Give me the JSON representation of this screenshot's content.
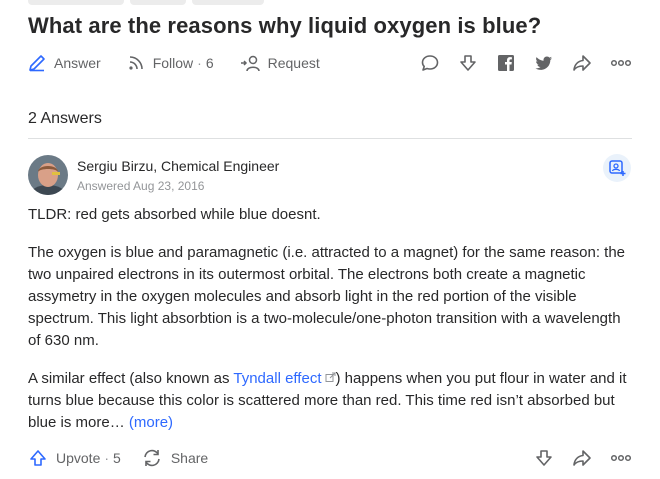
{
  "question": {
    "title": "What are the reasons why liquid oxygen is blue?"
  },
  "actions": {
    "answer_label": "Answer",
    "follow_label": "Follow",
    "follow_count": "6",
    "request_label": "Request"
  },
  "answers_header": "2 Answers",
  "answer": {
    "author": "Sergiu Birzu, Chemical Engineer",
    "answered": "Answered Aug 23, 2016",
    "tldr": "TLDR: red gets absorbed while blue doesnt.",
    "para1": "The oxygen is blue and paramagnetic (i.e. attracted to a magnet) for the same reason: the two unpaired electrons in its outermost orbital. The electrons both create a magnetic assymetry in the oxygen molecules and absorb light in the red portion of the visible spectrum. This light absorbtion is a two-molecule/one-photon transition with a wavelength of 630 nm.",
    "para2_before": "A similar effect (also known as ",
    "para2_link": "Tyndall effect",
    "para2_after": ") happens when you put flour in water and it turns blue because this color is scattered more than red. This time red isn’t absorbed but blue is more… ",
    "more_label": "(more)",
    "upvote_label": "Upvote",
    "upvote_count": "5",
    "share_label": "Share"
  },
  "colors": {
    "text": "#282829",
    "muted": "#636466",
    "link": "#2e69ff",
    "divider": "#dee0e1"
  },
  "icons": [
    "edit-icon",
    "follow-feed-icon",
    "request-icon",
    "comment-icon",
    "downvote-icon",
    "facebook-icon",
    "twitter-icon",
    "share-icon",
    "more-icon",
    "follow-author-icon",
    "upvote-icon",
    "reshare-icon"
  ]
}
